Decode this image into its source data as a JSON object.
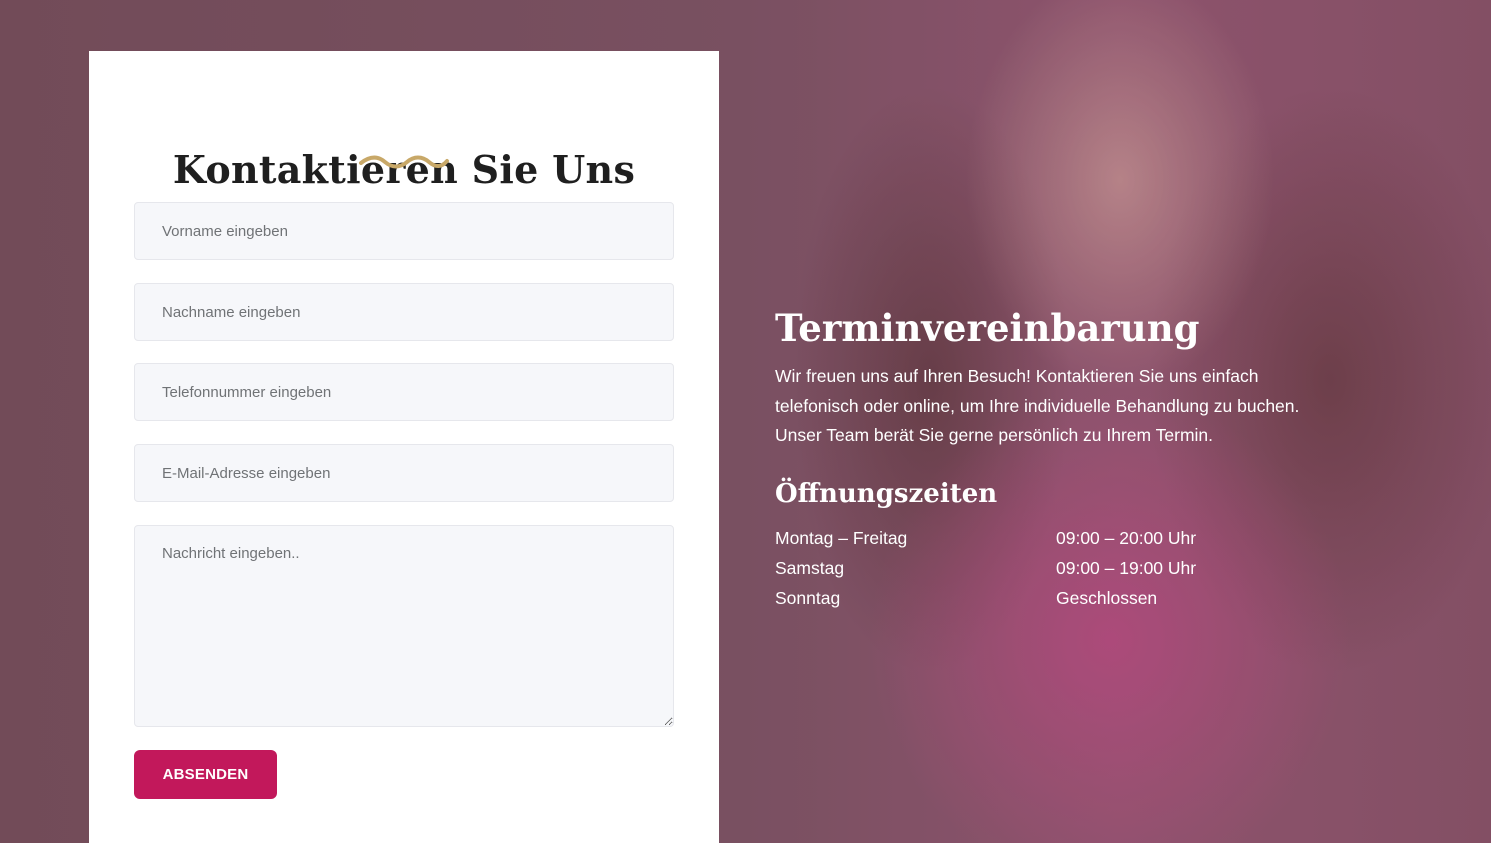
{
  "colors": {
    "accent": "#c2185b",
    "squiggle": "#c8a868",
    "card_bg": "#ffffff",
    "field_bg": "#f6f7fa"
  },
  "form": {
    "title": "Kontaktieren Sie Uns",
    "fields": {
      "firstname_placeholder": "Vorname eingeben",
      "lastname_placeholder": "Nachname eingeben",
      "phone_placeholder": "Telefonnummer eingeben",
      "email_placeholder": "E-Mail-Adresse eingeben",
      "message_placeholder": "Nachricht eingeben.."
    },
    "submit_label": "ABSENDEN"
  },
  "appointment": {
    "title": "Terminvereinbarung",
    "text": "Wir freuen uns auf Ihren Besuch! Kontaktieren Sie uns einfach telefonisch oder online, um Ihre individuelle Behandlung zu buchen. Unser Team berät Sie gerne persönlich zu Ihrem Termin."
  },
  "opening_hours": {
    "title": "Öffnungszeiten",
    "rows": [
      {
        "day": "Montag – Freitag",
        "time": "09:00 – 20:00 Uhr"
      },
      {
        "day": "Samstag",
        "time": "09:00 – 19:00 Uhr"
      },
      {
        "day": "Sonntag",
        "time": "Geschlossen"
      }
    ]
  }
}
